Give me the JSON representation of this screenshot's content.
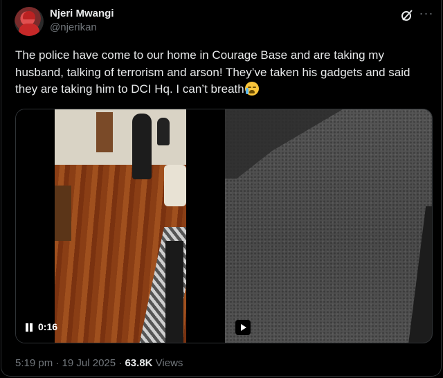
{
  "author": {
    "name": "Njeri Mwangi",
    "handle": "@njerikan"
  },
  "tweet": {
    "text": "The police have come to our home in Courage Base and are taking my husband, talking of terrorism and arson! They’ve taken his gadgets and said they are taking him to DCI Hq. I can’t breath"
  },
  "icons": {
    "grok": "grok-icon",
    "more": "more-icon",
    "emoji": "loudly-crying-face"
  },
  "media": {
    "video_time": "0:16"
  },
  "meta": {
    "time": "5:19 pm",
    "date": "19 Jul 2025",
    "views_count": "63.8K",
    "views_label": "Views",
    "separator": "·"
  }
}
